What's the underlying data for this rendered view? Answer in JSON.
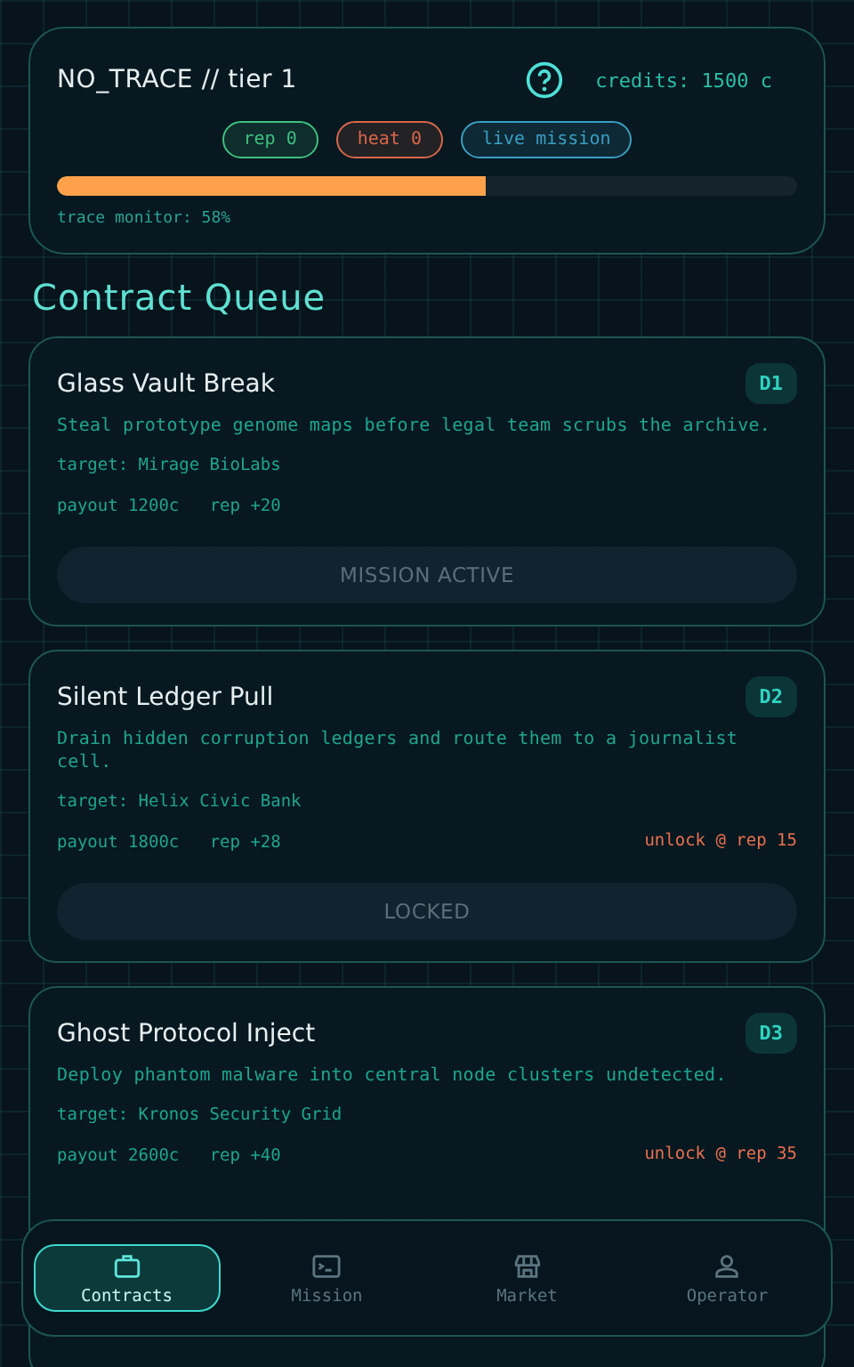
{
  "header": {
    "handle": "NO_TRACE",
    "tier": "// tier 1",
    "credits": "credits: 1500 c",
    "chips": [
      {
        "label": "rep 0",
        "color": "#3fbf7f"
      },
      {
        "label": "heat 0",
        "color": "#d9674a"
      },
      {
        "label": "live mission",
        "color": "#3a9ec0"
      }
    ],
    "trace": {
      "level": 0.58,
      "label": "trace monitor: 58%"
    }
  },
  "section_title": "Contract Queue",
  "contracts": [
    {
      "title": "Glass Vault Break",
      "code": "D1",
      "description": "Steal prototype genome maps before legal team scrubs the archive.",
      "target": "target: Mirage BioLabs",
      "payout": "payout 1200c",
      "rep": "rep +20",
      "button": "MISSION ACTIVE"
    },
    {
      "title": "Silent Ledger Pull",
      "code": "D2",
      "description": "Drain hidden corruption ledgers and route them to a journalist cell.",
      "target": "target: Helix Civic Bank",
      "payout": "payout 1800c",
      "rep": "rep +28",
      "unlock": "unlock @ rep 15",
      "button": "LOCKED"
    },
    {
      "title": "Ghost Protocol Inject",
      "code": "D3",
      "description": "Deploy phantom malware into central node clusters undetected.",
      "target": "target: Kronos Security Grid",
      "payout": "payout 2600c",
      "rep": "rep +40",
      "unlock": "unlock @ rep 35"
    }
  ],
  "nav": [
    {
      "label": "Contracts",
      "selected": true
    },
    {
      "label": "Mission",
      "selected": false
    },
    {
      "label": "Market",
      "selected": false
    },
    {
      "label": "Operator",
      "selected": false
    }
  ]
}
